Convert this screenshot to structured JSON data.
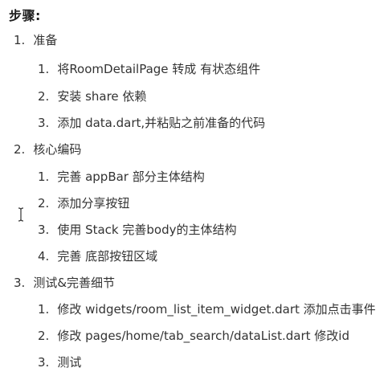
{
  "title": "步骤:",
  "sections": [
    {
      "num": "1.",
      "label": "准备",
      "items": [
        {
          "num": "1.",
          "text": "将RoomDetailPage 转成 有状态组件"
        },
        {
          "num": "2.",
          "text": "安装 share 依赖"
        },
        {
          "num": "3.",
          "text": "添加 data.dart,并粘贴之前准备的代码"
        }
      ]
    },
    {
      "num": "2.",
      "label": "核心编码",
      "items": [
        {
          "num": "1.",
          "text": "完善 appBar 部分主体结构"
        },
        {
          "num": "2.",
          "text": "添加分享按钮"
        },
        {
          "num": "3.",
          "text": "使用  Stack 完善body的主体结构"
        },
        {
          "num": "4.",
          "text": "完善 底部按钮区域"
        }
      ]
    },
    {
      "num": "3.",
      "label": "测试&完善细节",
      "items": [
        {
          "num": "1.",
          "text": "修改 widgets/room_list_item_widget.dart 添加点击事件"
        },
        {
          "num": "2.",
          "text": "修改 pages/home/tab_search/dataList.dart 修改id"
        },
        {
          "num": "3.",
          "text": "测试"
        }
      ]
    }
  ]
}
